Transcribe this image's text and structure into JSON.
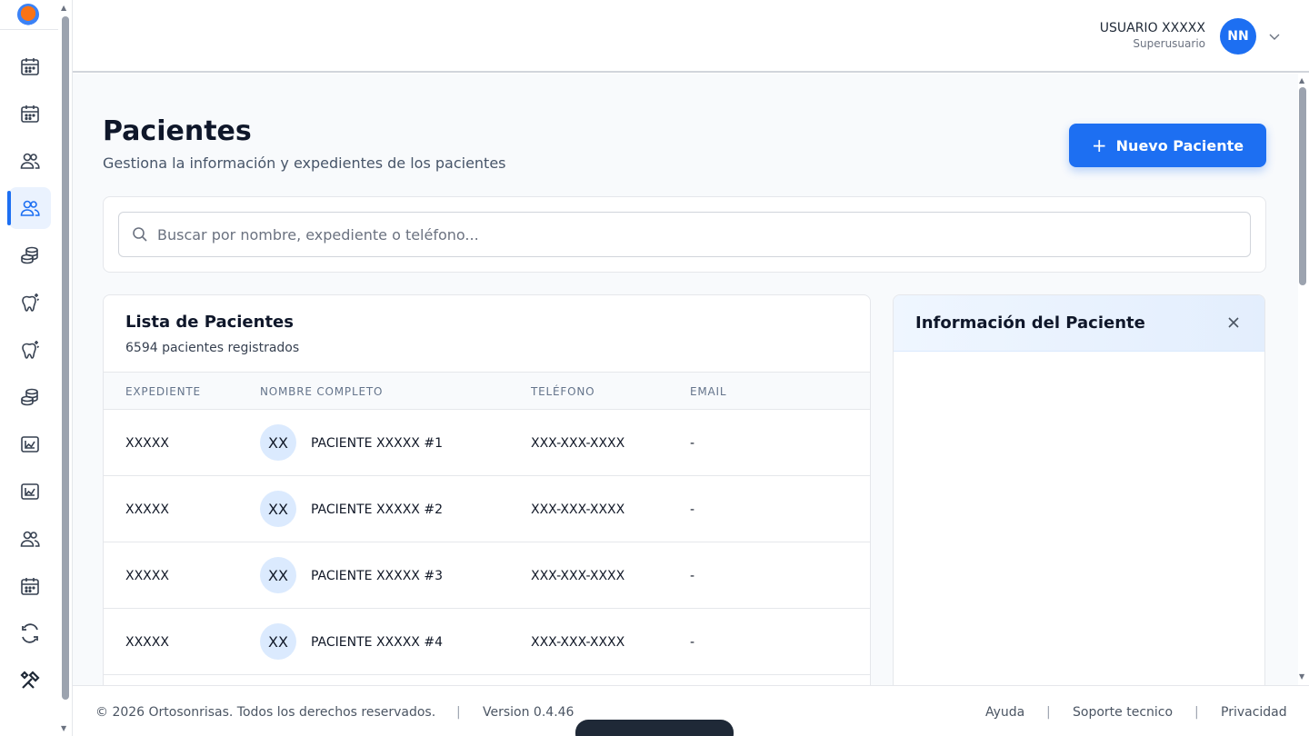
{
  "app": {
    "name": "Ortosonrisas"
  },
  "sidebar": {
    "items": [
      {
        "icon": "calendar-icon"
      },
      {
        "icon": "calendar-icon"
      },
      {
        "icon": "users-icon"
      },
      {
        "icon": "users-icon",
        "active": true
      },
      {
        "icon": "coins-icon"
      },
      {
        "icon": "tooth-sparkle-icon"
      },
      {
        "icon": "tooth-sparkle-icon"
      },
      {
        "icon": "coins-icon"
      },
      {
        "icon": "chart-icon"
      },
      {
        "icon": "chart-icon"
      },
      {
        "icon": "users-icon"
      },
      {
        "icon": "calendar-icon"
      },
      {
        "icon": "refresh-icon"
      },
      {
        "icon": "tools-icon"
      }
    ]
  },
  "header": {
    "user_name": "USUARIO XXXXX",
    "user_role": "Superusuario",
    "avatar_initials": "NN"
  },
  "page": {
    "title": "Pacientes",
    "subtitle": "Gestiona la información y expedientes de los pacientes",
    "new_button_plus": "+",
    "new_button_label": "Nuevo Paciente"
  },
  "search": {
    "value": "",
    "placeholder": "Buscar por nombre, expediente o teléfono..."
  },
  "patient_list": {
    "title": "Lista de Pacientes",
    "count_text": "6594 pacientes registrados",
    "columns": [
      "EXPEDIENTE",
      "NOMBRE COMPLETO",
      "TELÉFONO",
      "EMAIL"
    ],
    "rows": [
      {
        "expediente": "XXXXX",
        "initials": "XX",
        "name": "PACIENTE XXXXX #1",
        "phone": "XXX-XXX-XXXX",
        "email": "-"
      },
      {
        "expediente": "XXXXX",
        "initials": "XX",
        "name": "PACIENTE XXXXX #2",
        "phone": "XXX-XXX-XXXX",
        "email": "-"
      },
      {
        "expediente": "XXXXX",
        "initials": "XX",
        "name": "PACIENTE XXXXX #3",
        "phone": "XXX-XXX-XXXX",
        "email": "-"
      },
      {
        "expediente": "XXXXX",
        "initials": "XX",
        "name": "PACIENTE XXXXX #4",
        "phone": "XXX-XXX-XXXX",
        "email": "-"
      }
    ]
  },
  "info_panel": {
    "title": "Información del Paciente"
  },
  "footer": {
    "copyright": "© 2026 Ortosonrisas. Todos los derechos reservados.",
    "version": "Version 0.4.46",
    "links": [
      "Ayuda",
      "Soporte tecnico",
      "Privacidad"
    ],
    "separator": "|"
  },
  "colors": {
    "primary": "#1d6ff2",
    "active_bg": "#eaf2fe",
    "avatar_bg": "#dbeafe",
    "page_bg": "#f8fafc"
  }
}
